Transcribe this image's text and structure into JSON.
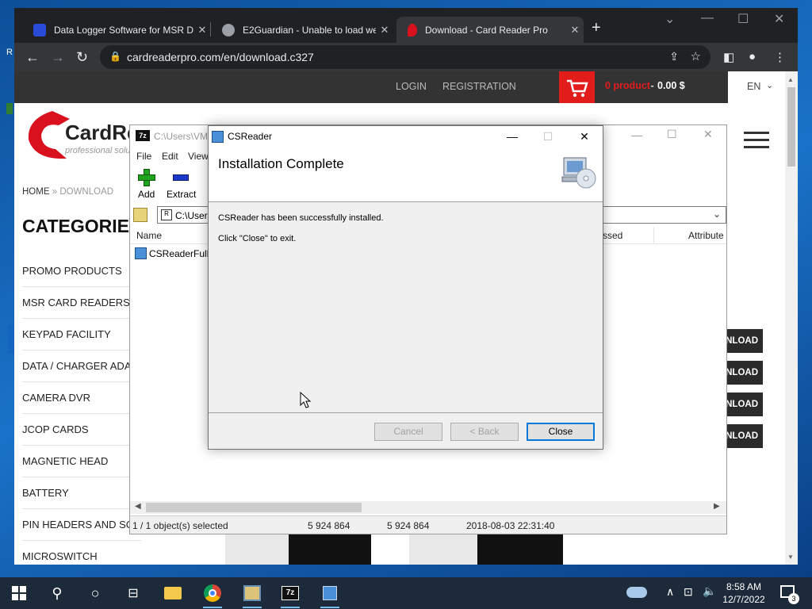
{
  "colors": {
    "accent": "#0078d7",
    "cart_red": "#e21b1b",
    "logo_red": "#d9111f",
    "site_dark": "#333333"
  },
  "browser": {
    "tabs": [
      {
        "title": "Data Logger Software for MSR D",
        "icon": "page-favicon-icon"
      },
      {
        "title": "E2Guardian - Unable to load wel",
        "icon": "globe-favicon-icon"
      },
      {
        "title": "Download - Card Reader Pro",
        "icon": "cardreader-favicon-icon"
      }
    ],
    "url": "cardreaderpro.com/en/download.c327"
  },
  "site": {
    "login": "LOGIN",
    "registration": "REGISTRATION",
    "cart_products": "0 product",
    "cart_sep": " - ",
    "cart_total": "0.00 $",
    "lang": "EN",
    "logo_text": "CardRe",
    "logo_sub": "professional soluti",
    "breadcrumb_home": "HOME",
    "breadcrumb_sep": "»",
    "breadcrumb_current": "DOWNLOAD",
    "categories_title": "CATEGORIES",
    "categories": [
      "PROMO PRODUCTS",
      "MSR CARD READERS",
      "KEYPAD FACILITY",
      "DATA / CHARGER ADA",
      "CAMERA DVR",
      "JCOP CARDS",
      "MAGNETIC HEAD",
      "BATTERY",
      "PIN HEADERS AND SC",
      "MICROSWITCH"
    ],
    "download_btn": "NLOAD"
  },
  "zip": {
    "title": "C:\\Users\\VM",
    "menus": [
      "File",
      "Edit",
      "View"
    ],
    "tools": {
      "add": "Add",
      "extract": "Extract"
    },
    "path": "C:\\Users",
    "columns": {
      "name": "Name",
      "packed": "ssed",
      "attributes": "Attribute"
    },
    "file_name": "CSReaderFull-",
    "status": {
      "selected": "1 / 1 object(s) selected",
      "size": "5 924 864",
      "packed": "5 924 864",
      "modified": "2018-08-03 22:31:40"
    }
  },
  "dialog": {
    "title": "CSReader",
    "heading": "Installation Complete",
    "line1": "CSReader has been successfully installed.",
    "line2": "Click \"Close\" to exit.",
    "cancel": "Cancel",
    "back": "< Back",
    "close": "Close"
  },
  "taskbar": {
    "time": "8:58 AM",
    "date": "12/7/2022",
    "notif_count": "3"
  }
}
